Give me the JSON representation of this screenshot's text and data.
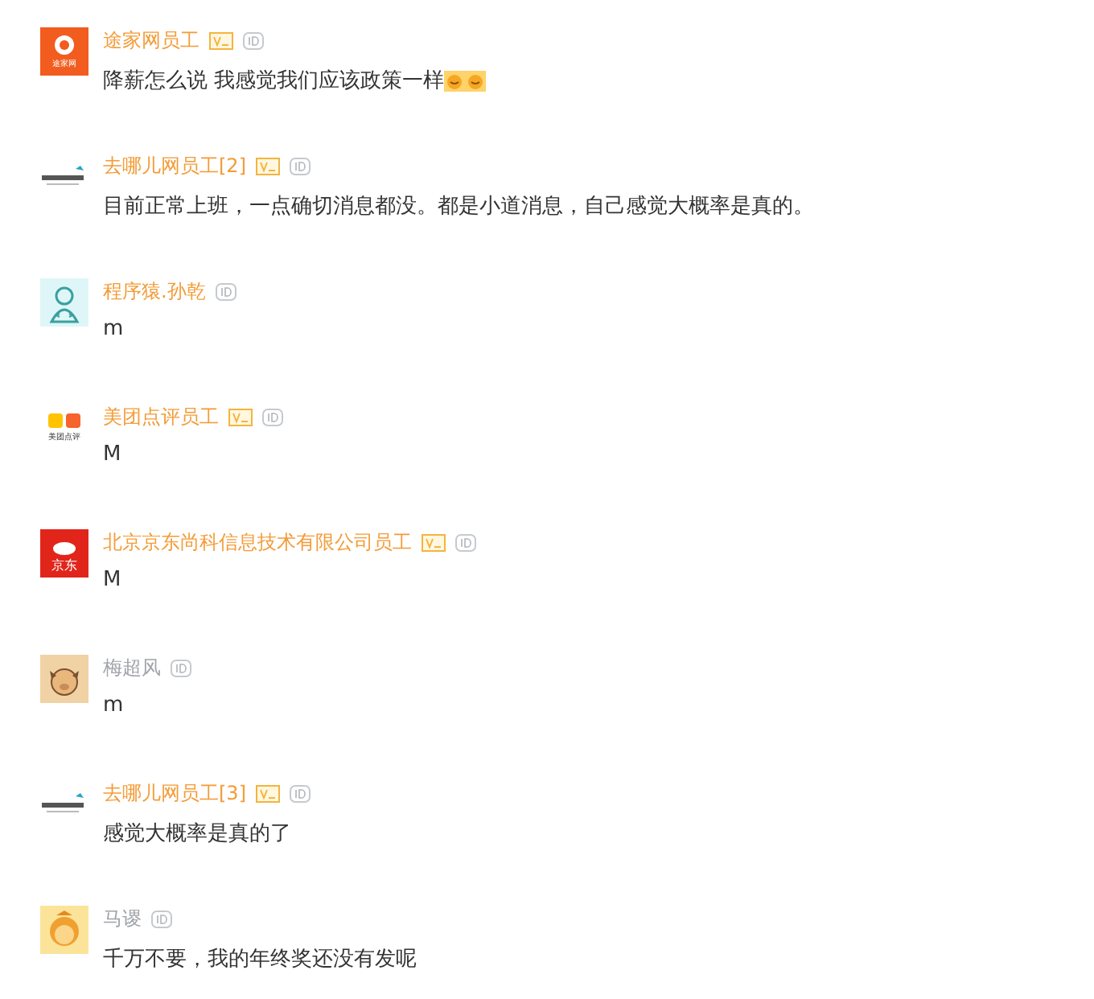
{
  "comments": [
    {
      "author": "途家网员工",
      "color": "#f39c38",
      "verified": true,
      "avatar": {
        "kind": "tujia",
        "text": "途家网"
      },
      "text": "降薪怎么说 我感觉我们应该政策一样",
      "emoji": true
    },
    {
      "author": "去哪儿网员工[2]",
      "color": "#f39c38",
      "verified": true,
      "avatar": {
        "kind": "qunar"
      },
      "text": "目前正常上班，一点确切消息都没。都是小道消息，自己感觉大概率是真的。",
      "emoji": false
    },
    {
      "author": "程序猿.孙乾",
      "color": "#f39c38",
      "verified": false,
      "avatar": {
        "kind": "coder"
      },
      "text": "m",
      "emoji": false
    },
    {
      "author": "美团点评员工",
      "color": "#f39c38",
      "verified": true,
      "avatar": {
        "kind": "meituan",
        "text": "美团点评"
      },
      "text": "M",
      "emoji": false
    },
    {
      "author": "北京京东尚科信息技术有限公司员工",
      "color": "#f39c38",
      "verified": true,
      "avatar": {
        "kind": "jd",
        "text": "京东"
      },
      "text": "M",
      "emoji": false
    },
    {
      "author": "梅超风",
      "color": "#a0a4aa",
      "verified": false,
      "avatar": {
        "kind": "pig"
      },
      "text": "m",
      "emoji": false
    },
    {
      "author": "去哪儿网员工[3]",
      "color": "#f39c38",
      "verified": true,
      "avatar": {
        "kind": "qunar"
      },
      "text": "感觉大概率是真的了",
      "emoji": false
    },
    {
      "author": "马谡",
      "color": "#a0a4aa",
      "verified": false,
      "avatar": {
        "kind": "monkey"
      },
      "text": "千万不要，我的年终奖还没有发呢",
      "emoji": false
    }
  ]
}
